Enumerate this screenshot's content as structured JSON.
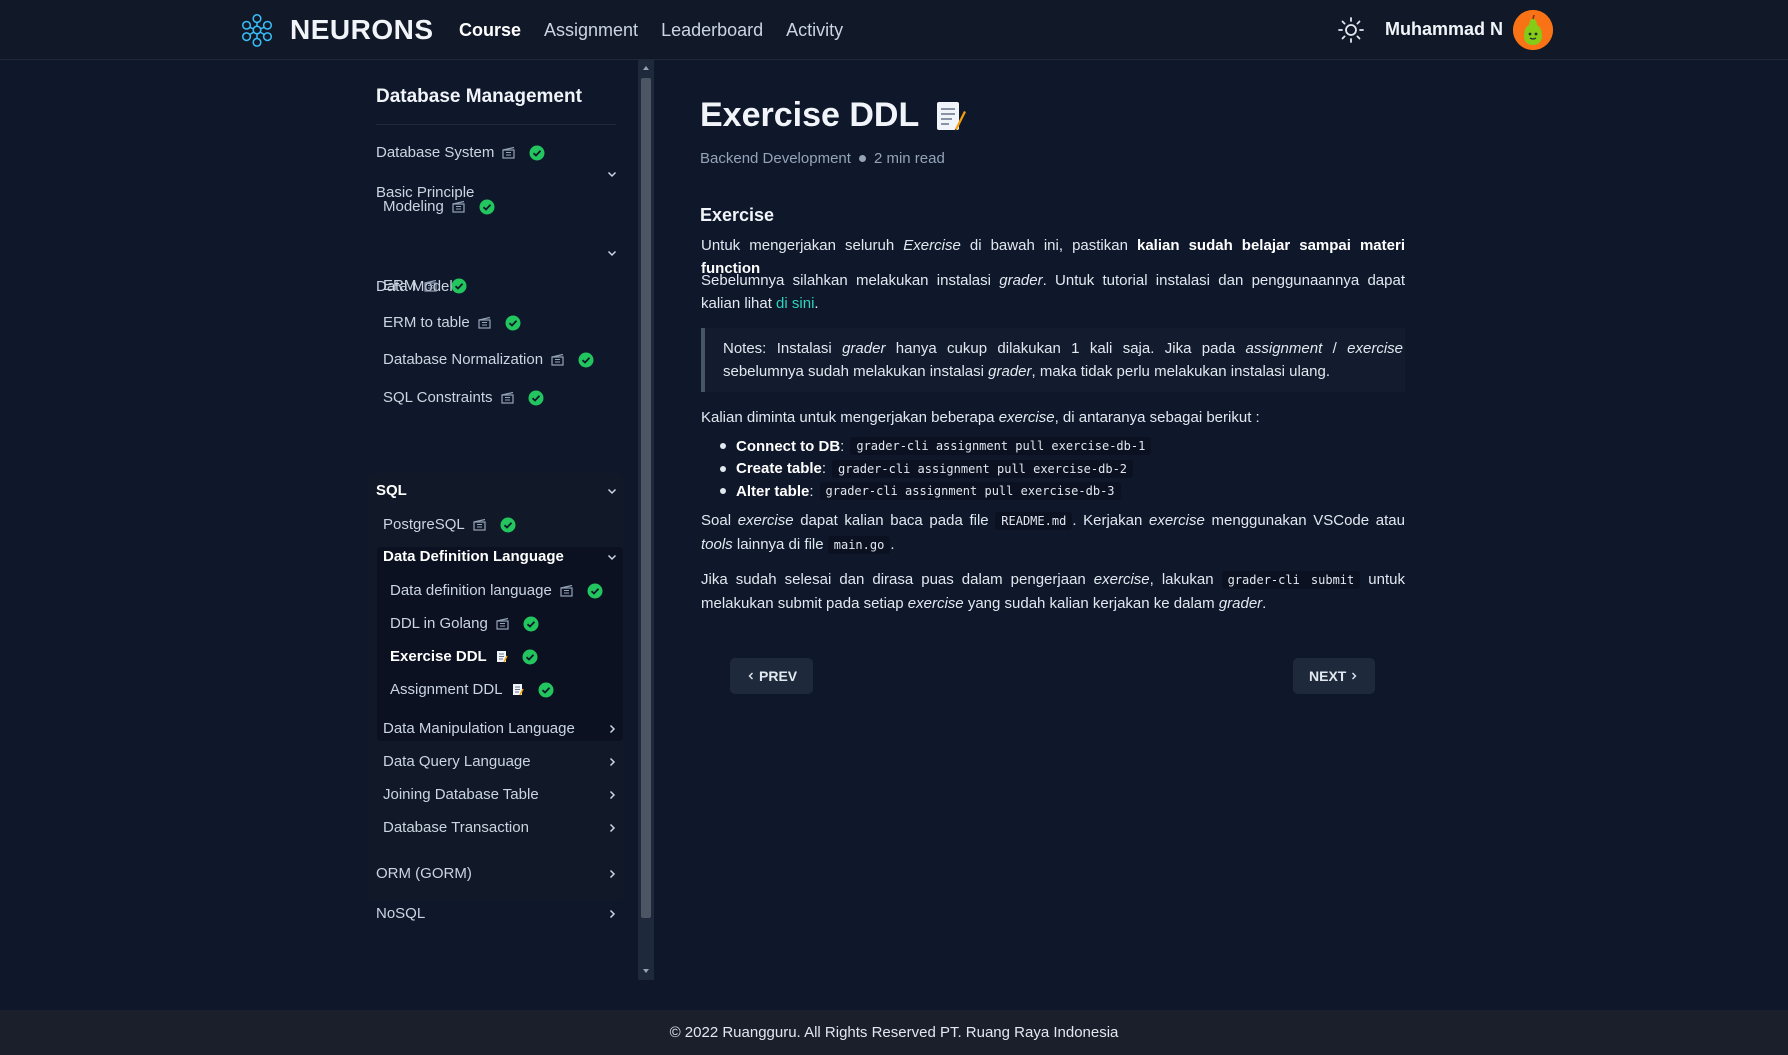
{
  "header": {
    "brand": "NEURONS",
    "nav": [
      "Course",
      "Assignment",
      "Leaderboard",
      "Activity"
    ],
    "active_nav": "Course",
    "user_name": "Muhammad N"
  },
  "sidebar": {
    "title": "Database Management",
    "items": {
      "database_system": "Database System",
      "basic_principle": "Basic Principle",
      "modeling": "Modeling",
      "data_model": "Data Model",
      "erm": "ERM",
      "erm_to_table": "ERM to table",
      "database_normalization": "Database Normalization",
      "sql_constraints": "SQL Constraints",
      "sql": "SQL",
      "postgresql": "PostgreSQL",
      "ddl_group": "Data Definition Language",
      "ddl_lesson": "Data definition language",
      "ddl_golang": "DDL in Golang",
      "exercise_ddl": "Exercise DDL",
      "assignment_ddl": "Assignment DDL",
      "dml": "Data Manipulation Language",
      "dql": "Data Query Language",
      "joining": "Joining Database Table",
      "transaction": "Database Transaction",
      "orm": "ORM (GORM)",
      "nosql": "NoSQL"
    }
  },
  "article": {
    "title": "Exercise DDL",
    "category": "Backend Development",
    "read_time": "2 min read",
    "heading": "Exercise",
    "p1_a": "Untuk mengerjakan seluruh ",
    "p1_b": "Exercise",
    "p1_c": " di bawah ini, pastikan ",
    "p1_d": "kalian sudah belajar sampai materi function",
    "p2_a": "Sebelumnya silahkan melakukan instalasi ",
    "p2_b": "grader",
    "p2_c": ". Untuk tutorial instalasi dan penggunaannya dapat kalian lihat ",
    "p2_link": "di sini",
    "p2_d": ".",
    "note_a": "Notes: Instalasi ",
    "note_b": "grader",
    "note_c": " hanya cukup dilakukan 1 kali saja. Jika pada ",
    "note_d": "assignment",
    "note_e": " / ",
    "note_f": "exercise",
    "note_g": " sebelumnya sudah melakukan instalasi ",
    "note_h": "grader",
    "note_i": ", maka tidak perlu melakukan instalasi ulang.",
    "p3_a": "Kalian diminta untuk mengerjakan beberapa ",
    "p3_b": "exercise",
    "p3_c": ", di antaranya sebagai berikut :",
    "bullets": [
      {
        "label": "Connect to DB",
        "sep": ":",
        "code": "grader-cli assignment pull exercise-db-1"
      },
      {
        "label": "Create table",
        "sep": ":",
        "code": "grader-cli assignment pull exercise-db-2"
      },
      {
        "label": "Alter table",
        "sep": ":",
        "code": "grader-cli assignment pull exercise-db-3"
      }
    ],
    "p4_a": "Soal ",
    "p4_b": "exercise",
    "p4_c": " dapat kalian baca pada file ",
    "p4_code1": "README.md",
    "p4_d": ". Kerjakan ",
    "p4_e": "exercise",
    "p4_f": " menggunakan VSCode atau ",
    "p4_g": "tools",
    "p4_h": " lainnya di file ",
    "p4_code2": "main.go",
    "p4_i": ".",
    "p5_a": "Jika sudah selesai dan dirasa puas dalam pengerjaan ",
    "p5_b": "exercise",
    "p5_c": ", lakukan ",
    "p5_code": "grader-cli submit",
    "p5_d": " untuk melakukan submit pada setiap ",
    "p5_e": "exercise",
    "p5_f": " yang sudah kalian kerjakan ke dalam ",
    "p5_g": "grader",
    "p5_h": ".",
    "prev_label": "PREV",
    "next_label": "NEXT"
  },
  "footer": {
    "text": "© 2022 Ruangguru. All Rights Reserved PT. Ruang Raya Indonesia"
  },
  "colors": {
    "background": "#0f172a",
    "header": "#111827",
    "accent_link": "#2dd4bf",
    "check": "#22c55e",
    "avatar": "#f97316"
  },
  "icons": {
    "brand": "neuron-network-icon",
    "theme": "sun-icon",
    "lesson": "film-clapper-icon",
    "done": "check-badge-icon",
    "exercise": "memo-icon"
  }
}
